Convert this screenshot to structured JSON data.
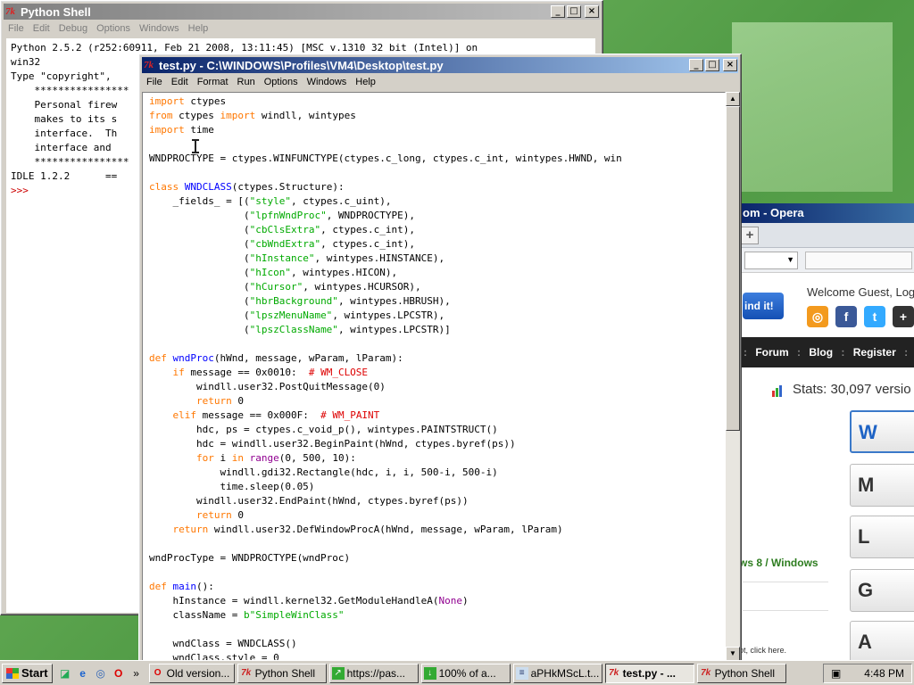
{
  "shell": {
    "title": "Python Shell",
    "menu": [
      "File",
      "Edit",
      "Debug",
      "Options",
      "Windows",
      "Help"
    ],
    "lines": [
      "Python 2.5.2 (r252:60911, Feb 21 2008, 13:11:45) [MSC v.1310 32 bit (Intel)] on",
      "win32",
      "Type \"copyright\",",
      "",
      "    ****************",
      "    Personal firew",
      "    makes to its s",
      "    interface.  Th",
      "    interface and ",
      "    ****************",
      "",
      "IDLE 1.2.2      ==",
      ">>> "
    ]
  },
  "editor": {
    "title": "test.py - C:\\WINDOWS\\Profiles\\VM4\\Desktop\\test.py",
    "menu": [
      "File",
      "Edit",
      "Format",
      "Run",
      "Options",
      "Windows",
      "Help"
    ]
  },
  "opera": {
    "title": "om - Opera",
    "find_label": "ind it!",
    "welcome": "Welcome Guest, Log",
    "nav": [
      "Forum",
      "Blog",
      "Register"
    ],
    "stats": "Stats: 30,097 versio",
    "win_link": "ws 8 / Windows",
    "click_text": "ot, click here.",
    "os_letters": [
      "W",
      "M",
      "L",
      "G",
      "A"
    ]
  },
  "taskbar": {
    "start": "Start",
    "tasks": [
      {
        "label": "Old version...",
        "icon": "opera-icon"
      },
      {
        "label": "Python Shell",
        "icon": "idle-icon"
      },
      {
        "label": "https://pas...",
        "icon": "browser-icon"
      },
      {
        "label": "100% of a...",
        "icon": "download-icon"
      },
      {
        "label": "aPHkMScL.t...",
        "icon": "notepad-icon"
      },
      {
        "label": "test.py - ...",
        "icon": "idle-icon"
      },
      {
        "label": "Python Shell",
        "icon": "idle-icon"
      }
    ],
    "clock": "4:48 PM",
    "more": "»"
  }
}
